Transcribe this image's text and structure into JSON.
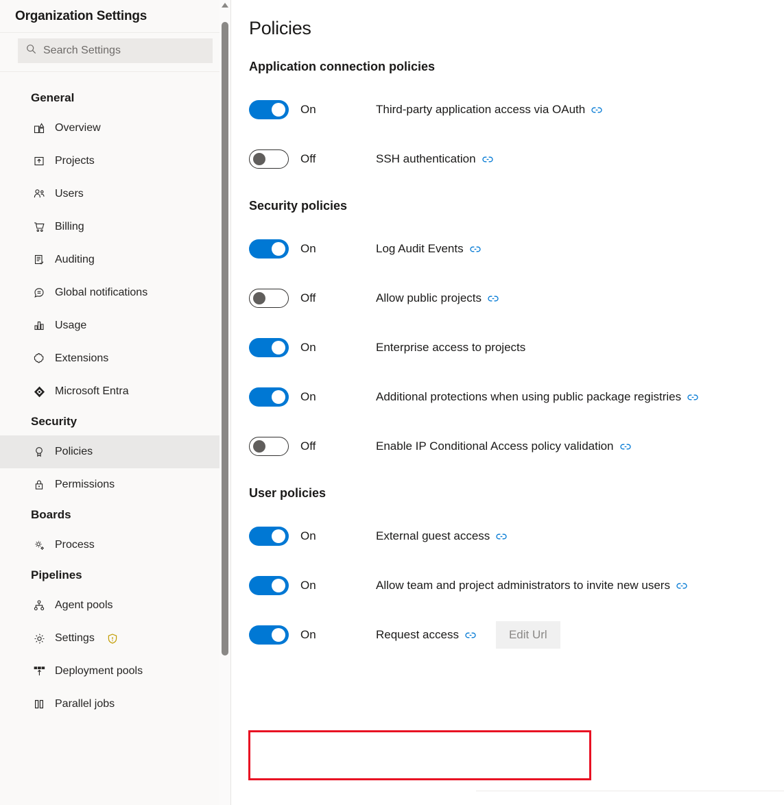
{
  "sidebar": {
    "header_title": "Organization Settings",
    "search": {
      "placeholder": "Search Settings",
      "value": "",
      "icon": "search-icon"
    },
    "groups": [
      {
        "title": "General",
        "items": [
          {
            "label": "Overview",
            "icon": "overview-icon",
            "active": false
          },
          {
            "label": "Projects",
            "icon": "projects-icon",
            "active": false
          },
          {
            "label": "Users",
            "icon": "users-icon",
            "active": false
          },
          {
            "label": "Billing",
            "icon": "billing-cart-icon",
            "active": false
          },
          {
            "label": "Auditing",
            "icon": "auditing-icon",
            "active": false
          },
          {
            "label": "Global notifications",
            "icon": "notifications-icon",
            "active": false
          },
          {
            "label": "Usage",
            "icon": "usage-chart-icon",
            "active": false
          },
          {
            "label": "Extensions",
            "icon": "extensions-puzzle-icon",
            "active": false
          },
          {
            "label": "Microsoft Entra",
            "icon": "microsoft-entra-icon",
            "active": false
          }
        ]
      },
      {
        "title": "Security",
        "items": [
          {
            "label": "Policies",
            "icon": "policies-ribbon-icon",
            "active": true
          },
          {
            "label": "Permissions",
            "icon": "permissions-lock-icon",
            "active": false
          }
        ]
      },
      {
        "title": "Boards",
        "items": [
          {
            "label": "Process",
            "icon": "process-gear-icon",
            "active": false
          }
        ]
      },
      {
        "title": "Pipelines",
        "items": [
          {
            "label": "Agent pools",
            "icon": "agent-pools-icon",
            "active": false
          },
          {
            "label": "Settings",
            "icon": "settings-gear-icon",
            "active": false,
            "warning": "warning-shield-icon"
          },
          {
            "label": "Deployment pools",
            "icon": "deployment-pools-icon",
            "active": false
          },
          {
            "label": "Parallel jobs",
            "icon": "parallel-jobs-icon",
            "active": false
          }
        ]
      }
    ],
    "scrollbar": {
      "up_arrow_icon": "scroll-up-arrow-icon"
    }
  },
  "main": {
    "page_title": "Policies",
    "sections": [
      {
        "title": "Application connection policies",
        "policies": [
          {
            "state": "On",
            "on": true,
            "label": "Third-party application access via OAuth",
            "link": true
          },
          {
            "state": "Off",
            "on": false,
            "label": "SSH authentication",
            "link": true
          }
        ]
      },
      {
        "title": "Security policies",
        "policies": [
          {
            "state": "On",
            "on": true,
            "label": "Log Audit Events",
            "link": true
          },
          {
            "state": "Off",
            "on": false,
            "label": "Allow public projects",
            "link": true
          },
          {
            "state": "On",
            "on": true,
            "label": "Enterprise access to projects",
            "link": false
          },
          {
            "state": "On",
            "on": true,
            "label": "Additional protections when using public package registries",
            "link": true
          },
          {
            "state": "Off",
            "on": false,
            "label": "Enable IP Conditional Access policy validation",
            "link": true
          }
        ]
      },
      {
        "title": "User policies",
        "policies": [
          {
            "state": "On",
            "on": true,
            "label": "External guest access",
            "link": true
          },
          {
            "state": "On",
            "on": true,
            "label": "Allow team and project administrators to invite new users",
            "link": true
          },
          {
            "state": "On",
            "on": true,
            "label": "Request access",
            "link": true,
            "button": "Edit Url",
            "highlighted": true
          }
        ]
      }
    ]
  },
  "colors": {
    "toggle_on": "#0078d4",
    "link_icon": "#0078d4",
    "highlight_box": "#e81123",
    "warning_shield": "#c19c00",
    "sidebar_bg": "#faf9f8",
    "active_item_bg": "#e9e8e7"
  }
}
